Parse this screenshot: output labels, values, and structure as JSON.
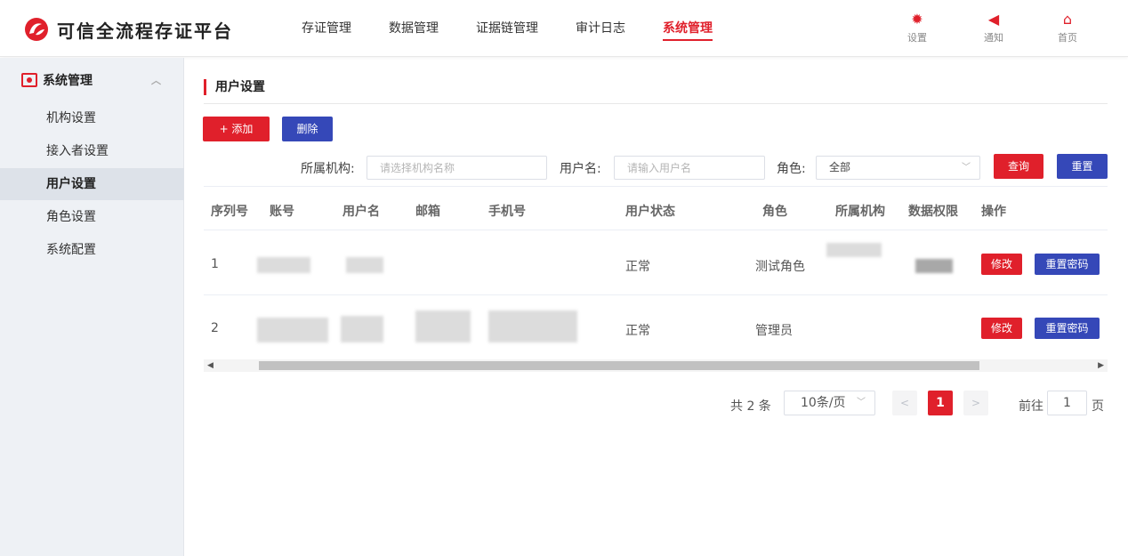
{
  "app": {
    "title": "可信全流程存证平台",
    "brand_color": "#e0202b",
    "accent_blue": "#3548b8"
  },
  "nav": {
    "items": [
      {
        "label": "存证管理"
      },
      {
        "label": "数据管理"
      },
      {
        "label": "证据链管理"
      },
      {
        "label": "审计日志"
      },
      {
        "label": "系统管理",
        "active": true
      }
    ]
  },
  "header_actions": {
    "settings": {
      "label": "设置",
      "icon": "gear-icon"
    },
    "notify": {
      "label": "通知",
      "icon": "megaphone-icon"
    },
    "home": {
      "label": "首页",
      "icon": "home-icon"
    }
  },
  "sidebar": {
    "section": "系统管理",
    "items": [
      {
        "label": "机构设置"
      },
      {
        "label": "接入者设置"
      },
      {
        "label": "用户设置",
        "active": true
      },
      {
        "label": "角色设置"
      },
      {
        "label": "系统配置"
      }
    ]
  },
  "page": {
    "title": "用户设置"
  },
  "toolbar": {
    "add_label": "+ 添加",
    "delete_label": "删除"
  },
  "filters": {
    "org_label": "所属机构:",
    "org_placeholder": "请选择机构名称",
    "username_label": "用户名:",
    "username_placeholder": "请输入用户名",
    "role_label": "角色:",
    "role_value": "全部",
    "query_label": "查询",
    "reset_label": "重置"
  },
  "table": {
    "columns": [
      "序列号",
      "账号",
      "用户名",
      "邮箱",
      "手机号",
      "用户状态",
      "角色",
      "所属机构",
      "数据权限",
      "操作"
    ],
    "rows": [
      {
        "index": "1",
        "status": "正常",
        "role": "测试角色",
        "edit": "修改",
        "reset_pwd": "重置密码"
      },
      {
        "index": "2",
        "status": "正常",
        "role": "管理员",
        "edit": "修改",
        "reset_pwd": "重置密码"
      }
    ]
  },
  "pagination": {
    "total": "共 2 条",
    "page_size": "10条/页",
    "current": "1",
    "goto_label": "前往",
    "goto_value": "1",
    "page_suffix": "页"
  }
}
